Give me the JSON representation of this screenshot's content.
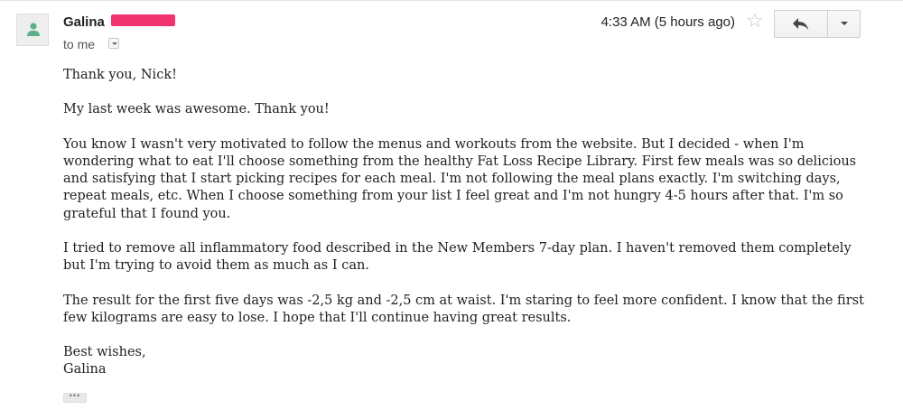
{
  "email": {
    "sender_name": "Galina",
    "recipient": "to me",
    "timestamp": "4:33 AM (5 hours ago)",
    "paragraphs": [
      "Thank you, Nick!",
      "My last week was awesome. Thank you!",
      "You know I wasn't very motivated to follow the menus and workouts from the website. But I decided - when I'm wondering what to eat I'll choose something from the healthy Fat Loss Recipe Library. First few meals was so delicious and satisfying that I start picking recipes for each meal. I'm not following the meal plans exactly. I'm switching days, repeat meals, etc. When I choose something from your list I feel great and I'm not hungry 4-5 hours after that. I'm so grateful that I found you.",
      "I tried to remove all inflammatory food described in the New Members 7-day plan. I haven't removed them completely but I'm trying to avoid them as much as I can.",
      "The result for the first five days was -2,5 kg and -2,5 cm at waist. I'm staring to feel more confident. I know that the first few kilograms are easy to lose. I hope that I'll continue having great results."
    ],
    "signoff": "Best wishes,",
    "signature": "Galina",
    "trimmed_indicator": "•••"
  },
  "icons": {
    "avatar": "person-icon",
    "star": "star-outline-icon",
    "reply": "reply-arrow-icon",
    "more": "chevron-down-icon",
    "details": "chevron-down-icon"
  },
  "colors": {
    "redaction": "#f0336e",
    "avatar_icon": "#5bb08a"
  }
}
